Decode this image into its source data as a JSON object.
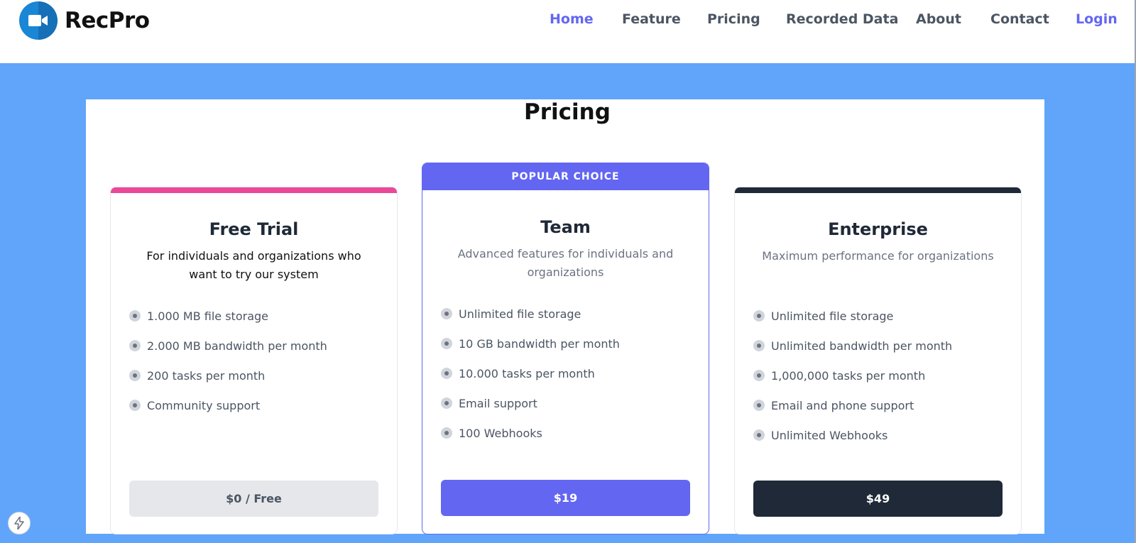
{
  "brand": {
    "name": "RecPro",
    "logo_icon": "video-camera-icon"
  },
  "nav": {
    "items": [
      {
        "label": "Home",
        "active": true
      },
      {
        "label": "Feature"
      },
      {
        "label": "Pricing"
      },
      {
        "label": "Recorded Data"
      },
      {
        "label": "About"
      },
      {
        "label": "Contact"
      },
      {
        "label": "Login"
      }
    ]
  },
  "section": {
    "title": "Pricing"
  },
  "plans": [
    {
      "name": "Free Trial",
      "description": "For individuals and organizations who want to try our system",
      "accent": "#ec4899",
      "features": [
        "1.000 MB file storage",
        "2.000 MB bandwidth per month",
        "200 tasks per month",
        "Community support"
      ],
      "price_label": "$0 / Free"
    },
    {
      "badge": "POPULAR CHOICE",
      "name": "Team",
      "description": "Advanced features for individuals and organizations",
      "accent": "#6366f1",
      "features": [
        "Unlimited file storage",
        "10 GB bandwidth per month",
        "10.000 tasks per month",
        "Email support",
        "100 Webhooks"
      ],
      "price_label": "$19"
    },
    {
      "name": "Enterprise",
      "description": "Maximum performance for organizations",
      "accent": "#1f2937",
      "features": [
        "Unlimited file storage",
        "Unlimited bandwidth per month",
        "1,000,000 tasks per month",
        "Email and phone support",
        "Unlimited Webhooks"
      ],
      "price_label": "$49"
    }
  ],
  "colors": {
    "section_bg": "#60a5fa",
    "primary": "#6366f1",
    "dark": "#1f2937",
    "pink": "#ec4899"
  },
  "floating_icon": "lightning-icon"
}
